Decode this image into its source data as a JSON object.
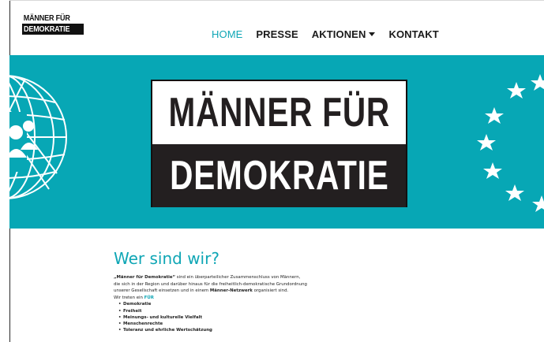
{
  "header": {
    "logo_line1": "MÄNNER FÜR",
    "logo_line2": "DEMOKRATIE",
    "nav": [
      {
        "label": "HOME",
        "active": true
      },
      {
        "label": "PRESSE",
        "active": false
      },
      {
        "label": "AKTIONEN",
        "active": false,
        "dropdown": true
      },
      {
        "label": "KONTAKT",
        "active": false
      }
    ]
  },
  "hero": {
    "background": "#07a7b5",
    "logo_line1": "MÄNNER FÜR",
    "logo_line2": "DEMOKRATIE"
  },
  "about": {
    "heading": "Wer sind wir?",
    "p1_bold": "„Männer für Demokratie“",
    "p1_a": " sind ein überparteilicher Zusammenschluss von Männern,",
    "p1_b": "die sich in der Region und darüber hinaus für die freiheitlich-demokratische Grundordnung",
    "p1_c": "unserer Gesellschaft einsetzen und in einem ",
    "p1_network": "Männer-Netzwerk",
    "p1_d": " organisiert sind.",
    "p2_a": "Wir treten ein ",
    "p2_accent": "FÜR",
    "items": [
      "Demokratie",
      "Freiheit",
      "Meinungs- und kulturelle Vielfalt",
      "Menschenrechte",
      "Toleranz und ehrliche Wertschätzung"
    ]
  },
  "colors": {
    "accent": "#0fa6b5",
    "dark": "#231f20"
  }
}
